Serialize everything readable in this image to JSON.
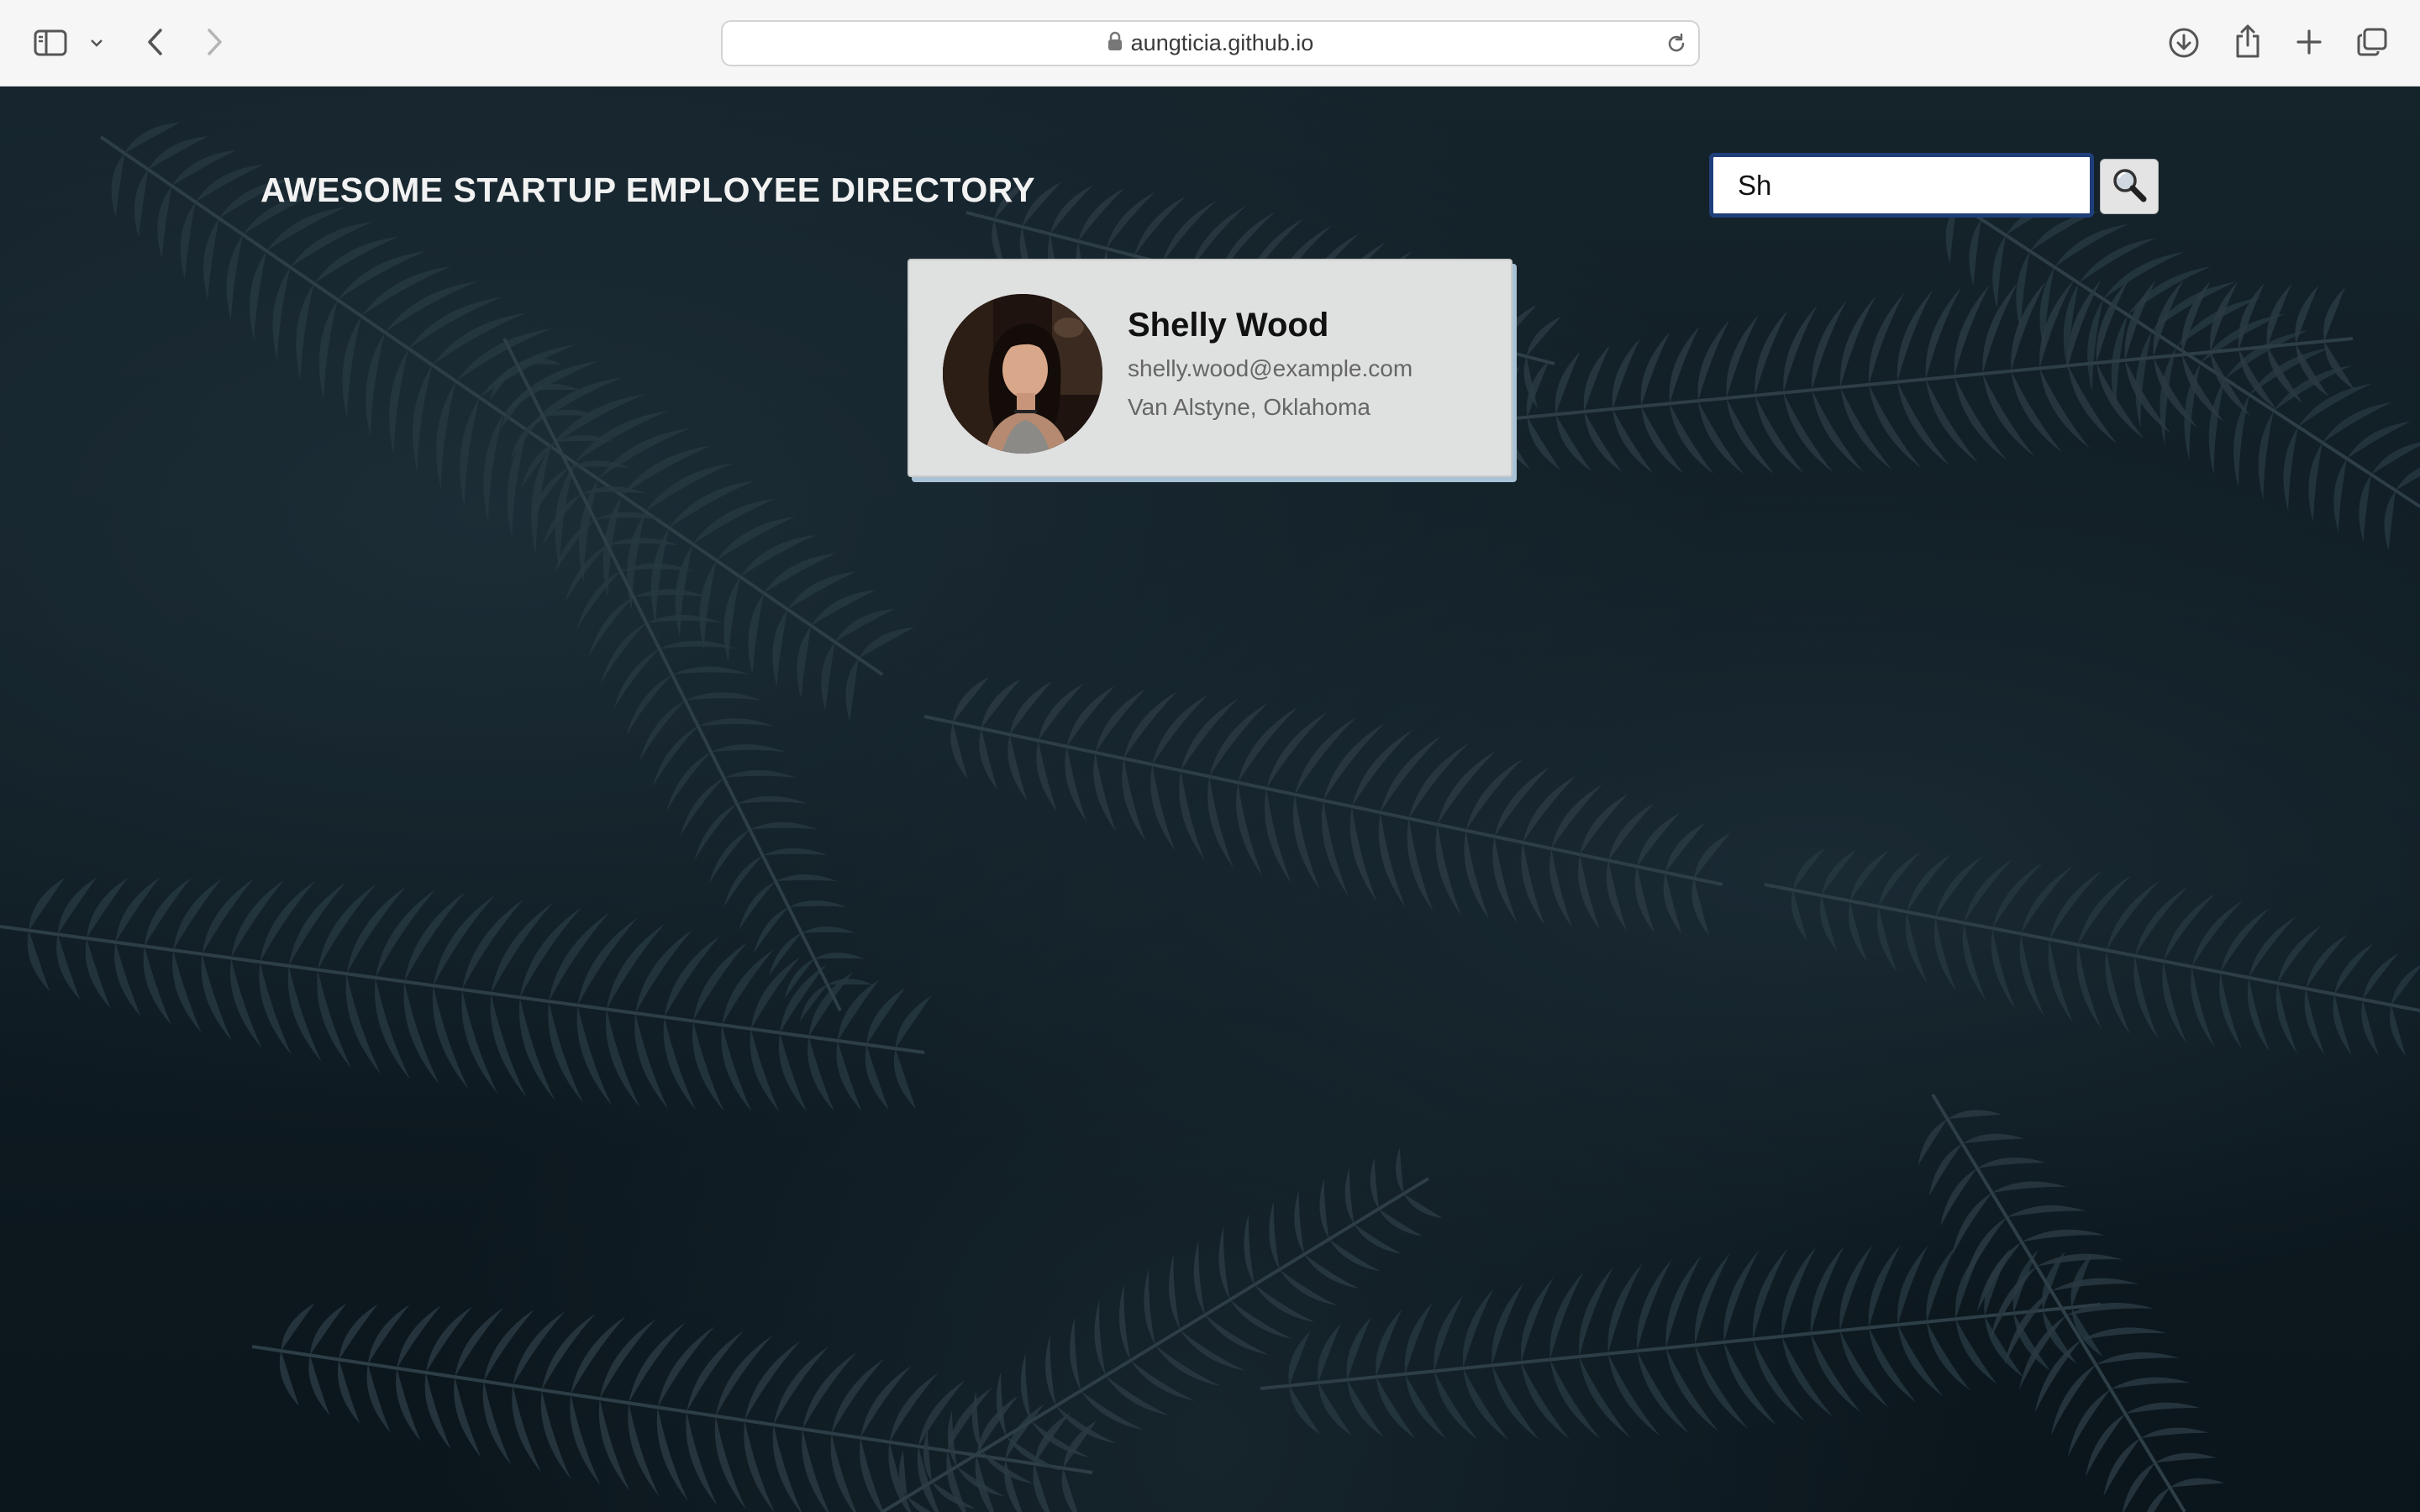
{
  "browser": {
    "url": "aungticia.github.io",
    "icons": {
      "sidebar": "sidebar-toggle-icon",
      "chevron": "chevron-down-icon",
      "back": "back-arrow-icon",
      "forward": "forward-arrow-icon",
      "lock": "lock-icon",
      "reload": "reload-icon",
      "download": "download-icon",
      "share": "share-icon",
      "new_tab": "plus-icon",
      "tabs": "tab-overview-icon"
    }
  },
  "page": {
    "title": "AWESOME STARTUP EMPLOYEE DIRECTORY",
    "background_color": "#0f1c23"
  },
  "search": {
    "value": "Sh",
    "icon": "magnifier-icon"
  },
  "employees": [
    {
      "name": "Shelly Wood",
      "email": "shelly.wood@example.com",
      "location": "Van Alstyne, Oklahoma"
    }
  ]
}
